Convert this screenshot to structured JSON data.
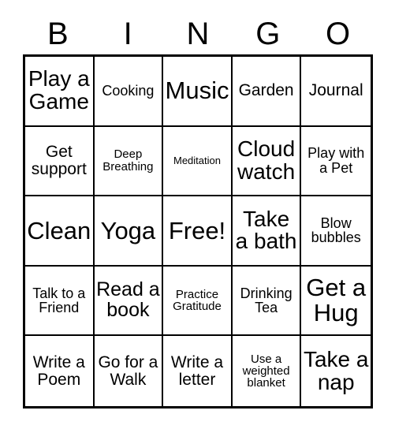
{
  "card": {
    "title_letters": [
      "B",
      "I",
      "N",
      "G",
      "O"
    ],
    "free_space_label": "Free!",
    "colors": {
      "background": "#ffffff",
      "text": "#000000",
      "grid_line": "#000000"
    },
    "grid": {
      "rows": 5,
      "columns": 5,
      "cells": [
        {
          "text": "Play a Game",
          "size": "xl"
        },
        {
          "text": "Cooking",
          "size": "sm"
        },
        {
          "text": "Music",
          "size": "xxl"
        },
        {
          "text": "Garden",
          "size": "md"
        },
        {
          "text": "Journal",
          "size": "md"
        },
        {
          "text": "Get support",
          "size": "md"
        },
        {
          "text": "Deep Breathing",
          "size": "xs"
        },
        {
          "text": "Meditation",
          "size": "xxs"
        },
        {
          "text": "Cloud watch",
          "size": "xl"
        },
        {
          "text": "Play with a Pet",
          "size": "sm"
        },
        {
          "text": "Clean",
          "size": "xxl"
        },
        {
          "text": "Yoga",
          "size": "xxl"
        },
        {
          "text": "Free!",
          "size": "xxl"
        },
        {
          "text": "Take a bath",
          "size": "xl"
        },
        {
          "text": "Blow bubbles",
          "size": "sm"
        },
        {
          "text": "Talk to a Friend",
          "size": "sm"
        },
        {
          "text": "Read a book",
          "size": "lg"
        },
        {
          "text": "Practice Gratitude",
          "size": "xs"
        },
        {
          "text": "Drinking Tea",
          "size": "sm"
        },
        {
          "text": "Get a Hug",
          "size": "xxl"
        },
        {
          "text": "Write a Poem",
          "size": "md"
        },
        {
          "text": "Go for a Walk",
          "size": "md"
        },
        {
          "text": "Write a letter",
          "size": "md"
        },
        {
          "text": "Use a weighted blanket",
          "size": "xs"
        },
        {
          "text": "Take a nap",
          "size": "xl"
        }
      ]
    }
  }
}
